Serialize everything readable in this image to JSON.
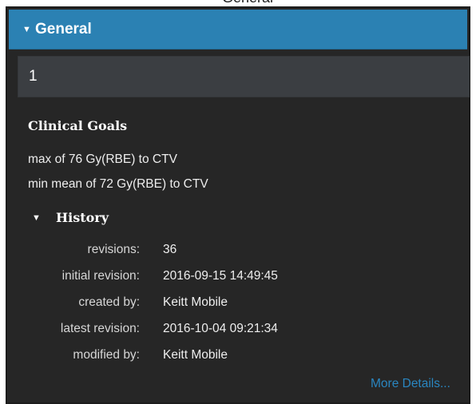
{
  "top_strip": {
    "text": "General"
  },
  "section": {
    "title": "General",
    "caret": "▼",
    "caret_icon": "caret-down-icon"
  },
  "item": {
    "title": "1"
  },
  "clinical_goals": {
    "heading": "Clinical Goals",
    "goals": [
      "max of 76 Gy(RBE) to CTV",
      "min mean of 72 Gy(RBE) to CTV"
    ]
  },
  "history": {
    "title": "History",
    "caret": "▼",
    "caret_icon": "caret-down-icon",
    "fields": [
      {
        "label": "revisions:",
        "value": "36"
      },
      {
        "label": "initial revision:",
        "value": "2016-09-15 14:49:45"
      },
      {
        "label": "created by:",
        "value": "Keitt Mobile"
      },
      {
        "label": "latest revision:",
        "value": "2016-10-04 09:21:34"
      },
      {
        "label": "modified by:",
        "value": "Keitt Mobile"
      }
    ]
  },
  "more_details": {
    "label": "More Details..."
  },
  "colors": {
    "header_blue": "#2b81b3",
    "panel_bg": "#262626",
    "item_bar": "#3b3e42",
    "link_blue": "#2a86c0"
  }
}
